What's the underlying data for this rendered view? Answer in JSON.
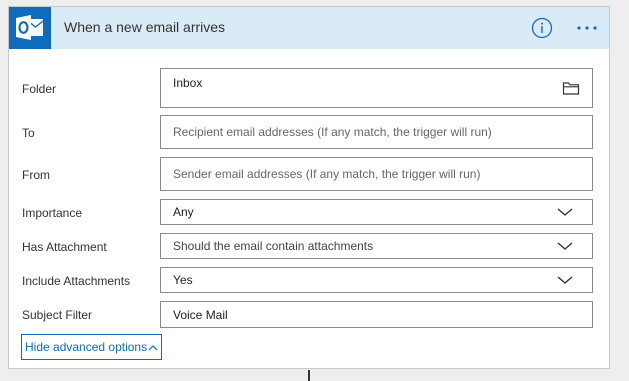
{
  "trigger": {
    "title": "When a new email arrives",
    "app_icon": "outlook-icon",
    "info_icon": "info-icon",
    "more_icon": "more-options-icon"
  },
  "fields": {
    "folder": {
      "label": "Folder",
      "value": "Inbox",
      "icon": "folder-icon"
    },
    "to": {
      "label": "To",
      "placeholder": "Recipient email addresses (If any match, the trigger will run)"
    },
    "from": {
      "label": "From",
      "placeholder": "Sender email addresses (If any match, the trigger will run)"
    },
    "importance": {
      "label": "Importance",
      "value": "Any",
      "icon": "chevron-down-icon"
    },
    "has_attachment": {
      "label": "Has Attachment",
      "placeholder": "Should the email contain attachments",
      "icon": "chevron-down-icon"
    },
    "include_attachments": {
      "label": "Include Attachments",
      "value": "Yes",
      "icon": "chevron-down-icon"
    },
    "subject_filter": {
      "label": "Subject Filter",
      "value": "Voice Mail"
    }
  },
  "advanced_toggle": {
    "label": "Hide advanced options",
    "icon": "chevron-up-icon"
  },
  "colors": {
    "header_bg": "#d9ebf7",
    "accent": "#0f6cbd",
    "border": "#8a8a8a"
  }
}
